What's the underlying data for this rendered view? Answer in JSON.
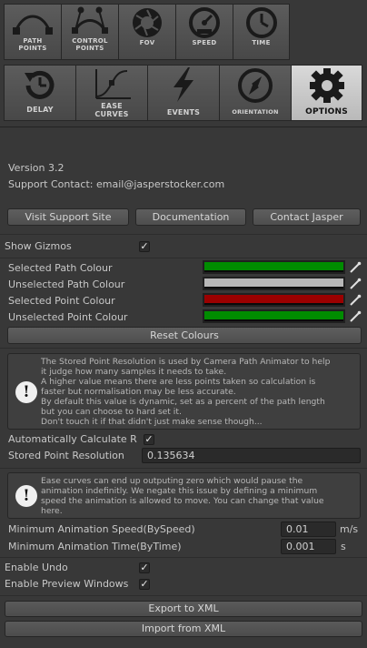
{
  "toolbar_top": [
    {
      "label": "PATH\nPOINTS",
      "icon": "path-points-icon"
    },
    {
      "label": "CONTROL\nPOINTS",
      "icon": "control-points-icon"
    },
    {
      "label": "FOV",
      "icon": "aperture-icon"
    },
    {
      "label": "SPEED",
      "icon": "speedometer-icon"
    },
    {
      "label": "TIME",
      "icon": "clock-icon"
    }
  ],
  "toolbar_bottom": [
    {
      "label": "DELAY",
      "icon": "delay-icon"
    },
    {
      "label": "EASE\nCURVES",
      "icon": "ease-curves-icon"
    },
    {
      "label": "EVENTS",
      "icon": "lightning-icon"
    },
    {
      "label": "ORIENTATION",
      "icon": "compass-icon"
    },
    {
      "label": "OPTIONS",
      "icon": "gear-icon",
      "active": true
    }
  ],
  "info": {
    "version": "Version 3.2",
    "contact": "Support Contact: email@jasperstocker.com"
  },
  "links": {
    "support": "Visit Support Site",
    "docs": "Documentation",
    "contact": "Contact Jasper"
  },
  "gizmos": {
    "label": "Show Gizmos",
    "checked": true
  },
  "colours": {
    "items": [
      {
        "label": "Selected Path Colour",
        "color": "#008c00"
      },
      {
        "label": "Unselected Path Colour",
        "color": "#b8b8b8"
      },
      {
        "label": "Selected Point Colour",
        "color": "#9b0000"
      },
      {
        "label": "Unselected Point Colour",
        "color": "#008c00"
      }
    ],
    "reset": "Reset Colours"
  },
  "resolution_help": [
    "The Stored Point Resolution is used by Camera Path Animator to help",
    "it judge how many samples it needs to take.",
    "A higher value means there are less points taken so calculation is",
    "faster but normalisation may be less accurate.",
    "By default this value is dynamic, set as a percent of the path length",
    "but you can choose to hard set it.",
    "Don't touch it if that didn't just make sense though..."
  ],
  "resolution": {
    "auto_label": "Automatically Calculate R",
    "auto_checked": true,
    "label": "Stored Point Resolution",
    "value": "0.135634"
  },
  "ease_help": [
    "Ease curves can end up outputing zero which would pause the",
    "animation indefinitly. We negate this issue by defining a minimum",
    "speed the animation is allowed to move. You can change that value",
    "here."
  ],
  "min_speed": {
    "label": "Minimum Animation Speed(BySpeed)",
    "value": "0.01",
    "unit": "m/s"
  },
  "min_time": {
    "label": "Minimum Animation Time(ByTime)",
    "value": "0.001",
    "unit": "s"
  },
  "undo": {
    "label": "Enable Undo",
    "checked": true
  },
  "preview": {
    "label": "Enable Preview Windows",
    "checked": true
  },
  "export_label": "Export to XML",
  "import_label": "Import from XML",
  "checkmark": "✓"
}
